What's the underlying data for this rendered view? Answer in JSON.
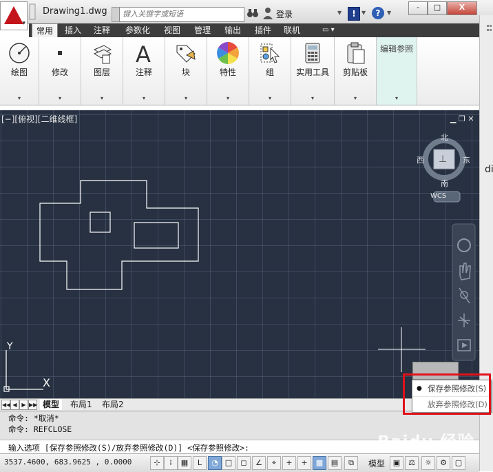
{
  "app": {
    "title": "Drawing1.dwg",
    "search_placeholder": "键入关键字或短语",
    "login_label": "登录",
    "exchange_label": "!",
    "help_label": "?",
    "window_buttons": {
      "minimize": "-",
      "restore": "□",
      "close": "X"
    }
  },
  "ribbon": {
    "tabs": [
      {
        "label": "常用",
        "active": true
      },
      {
        "label": "插入",
        "active": false
      },
      {
        "label": "注释",
        "active": false
      },
      {
        "label": "参数化",
        "active": false
      },
      {
        "label": "视图",
        "active": false
      },
      {
        "label": "管理",
        "active": false
      },
      {
        "label": "输出",
        "active": false
      },
      {
        "label": "插件",
        "active": false
      },
      {
        "label": "联机",
        "active": false
      }
    ],
    "panels": [
      {
        "label": "绘图",
        "icon": "draw-circle-icon"
      },
      {
        "label": "修改",
        "icon": "modify-icon"
      },
      {
        "label": "图层",
        "icon": "layers-icon"
      },
      {
        "label": "注释",
        "icon": "annotation-icon"
      },
      {
        "label": "块",
        "icon": "block-icon"
      },
      {
        "label": "特性",
        "icon": "properties-icon"
      },
      {
        "label": "组",
        "icon": "group-icon"
      },
      {
        "label": "实用工具",
        "icon": "calculator-icon"
      },
      {
        "label": "剪贴板",
        "icon": "clipboard-icon"
      },
      {
        "label": "编辑参照",
        "icon": ""
      }
    ],
    "expand_glyph": "▾"
  },
  "viewport": {
    "label": "[−][俯视][二维线框]",
    "controls": "▁ ❐ ✕",
    "viewcube": {
      "north": "北",
      "south": "南",
      "east": "东",
      "west": "西",
      "wcs": "WCS"
    },
    "ucs": {
      "x": "X",
      "y": "Y"
    }
  },
  "layout_tabs": {
    "nav": [
      "◀◀",
      "◀",
      "▶",
      "▶▶"
    ],
    "tabs": [
      {
        "label": "模型",
        "active": true
      },
      {
        "label": "布局1",
        "active": false
      },
      {
        "label": "布局2",
        "active": false
      }
    ]
  },
  "command": {
    "history": [
      "命令: *取消*",
      "命令: REFCLOSE"
    ],
    "prompt": "输入选项 [保存参照修改(S)/放弃参照修改(D)] <保存参照修改>:"
  },
  "context_menu": {
    "items": [
      {
        "label": "保存参照修改(S)",
        "checked": true
      },
      {
        "label": "放弃参照修改(D)",
        "checked": false
      }
    ],
    "bullet": "●"
  },
  "status": {
    "coords": "3537.4600, 683.9625 , 0.0000",
    "model_label": "模型"
  },
  "stray_text": "di",
  "watermark": "Baidu 经验",
  "colors": {
    "canvas": "#273142",
    "highlight": "#e0121a",
    "ribbon_tab_bar": "#3d3d3d"
  }
}
